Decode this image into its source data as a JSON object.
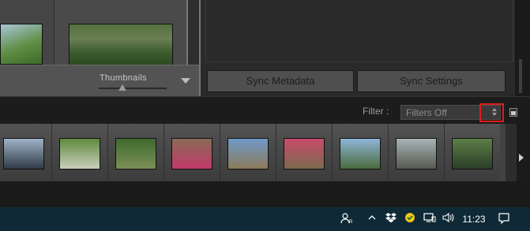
{
  "toolbar": {
    "thumbnails_label": "Thumbnails",
    "thumbnail_size_fraction": 0.35
  },
  "sync": {
    "metadata_label": "Sync Metadata",
    "settings_label": "Sync Settings"
  },
  "filter": {
    "label": "Filter :",
    "value": "Filters Off"
  },
  "filmstrip": {
    "thumbnails": [
      {
        "name": "photo-group-on-bridge",
        "colors": [
          "#9fb3c8",
          "#2f3a46"
        ]
      },
      {
        "name": "photo-tree-lined-path",
        "colors": [
          "#5f8a3e",
          "#c9cfbd"
        ]
      },
      {
        "name": "photo-stone-viaduct",
        "colors": [
          "#3f6b2e",
          "#7a8f55"
        ]
      },
      {
        "name": "photo-woman-on-rocks",
        "colors": [
          "#8a6a55",
          "#c23a6b"
        ]
      },
      {
        "name": "photo-hikers-on-summit",
        "colors": [
          "#6e9ac9",
          "#8c7a5a"
        ]
      },
      {
        "name": "photo-group-selfie",
        "colors": [
          "#c84a6a",
          "#7b6a4e"
        ]
      },
      {
        "name": "photo-mountain-valley",
        "colors": [
          "#8fb6d8",
          "#4a6a3c"
        ]
      },
      {
        "name": "photo-canyon-trail",
        "colors": [
          "#a7b3b7",
          "#555a4f"
        ]
      },
      {
        "name": "photo-forest-road",
        "colors": [
          "#5d7f46",
          "#2b3d27"
        ]
      }
    ]
  },
  "taskbar": {
    "clock": "11:23"
  },
  "colors": {
    "highlight": "#e01c1c",
    "taskbar": "#0f2a36"
  }
}
